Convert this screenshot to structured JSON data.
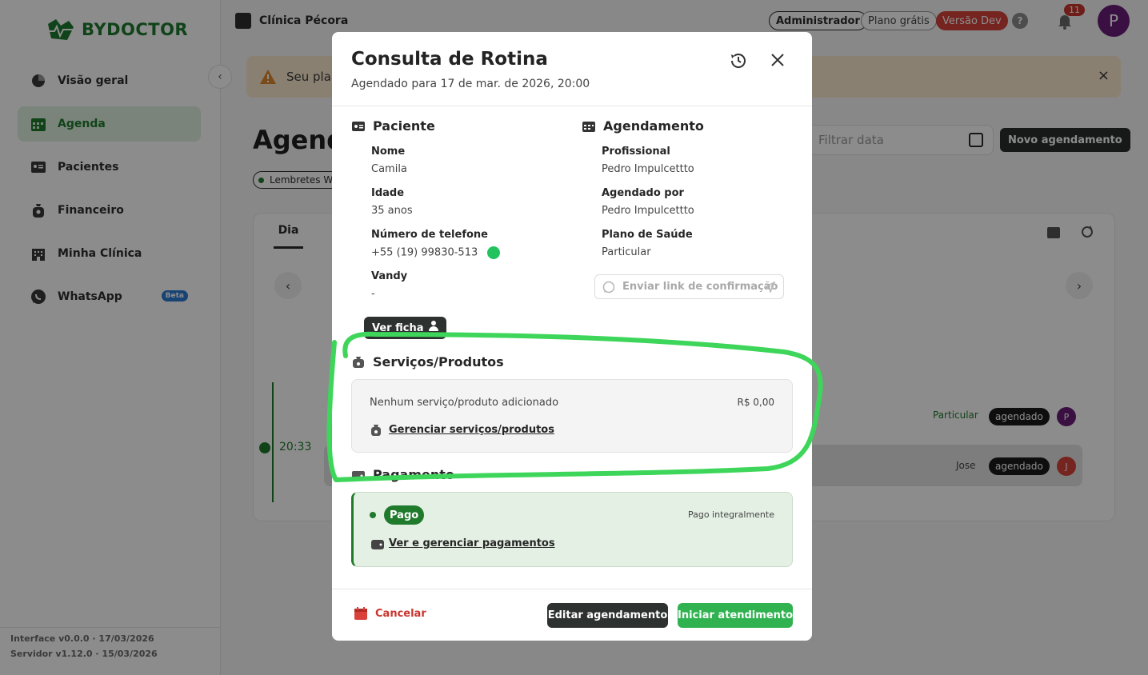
{
  "brand": {
    "name": "BYDOCTOR",
    "color": "#1e7a2e"
  },
  "sidebar": {
    "items": [
      {
        "label": "Visão geral",
        "icon": "pie-chart-icon"
      },
      {
        "label": "Agenda",
        "icon": "calendar-icon",
        "active": true
      },
      {
        "label": "Pacientes",
        "icon": "id-card-icon"
      },
      {
        "label": "Financeiro",
        "icon": "money-bag-icon"
      },
      {
        "label": "Minha Clínica",
        "icon": "building-icon"
      },
      {
        "label": "WhatsApp",
        "icon": "whatsapp-icon",
        "badge": "Beta"
      }
    ],
    "version_interface": "Interface v0.0.0 · 17/03/2026",
    "version_server": "Servidor v1.12.0 · 15/03/2026"
  },
  "header": {
    "clinic": "Clínica Pécora",
    "role": "Administrador",
    "plan": "Plano grátis",
    "env": "Versão Dev",
    "help": "?",
    "notifications": "11",
    "avatar": "P"
  },
  "background": {
    "banner_text": "Seu plan",
    "banner_close": "×",
    "title": "Agend",
    "reminder": "Lembretes W",
    "filter_placeholder": "Filtrar data",
    "new_button": "Novo agendamento",
    "tab": "Dia",
    "time": "20:33",
    "rows": [
      {
        "tag": "Particular",
        "status": "agendado",
        "avatar": "P"
      },
      {
        "tag": "Jose",
        "status": "agendado",
        "avatar": "J"
      }
    ]
  },
  "modal": {
    "title": "Consulta de Rotina",
    "subtitle": "Agendado para 17 de mar. de 2026, 20:00",
    "patient": {
      "heading": "Paciente",
      "name_label": "Nome",
      "name": "Camila",
      "age_label": "Idade",
      "age": "35 anos",
      "phone_label": "Número de telefone",
      "phone": "+55 (19) 99830-513",
      "vandy_label": "Vandy",
      "vandy": "-",
      "record_button": "Ver ficha"
    },
    "schedule": {
      "heading": "Agendamento",
      "professional_label": "Profissional",
      "professional": "Pedro Impulcettto",
      "by_label": "Agendado por",
      "by": "Pedro Impulcettto",
      "plan_label": "Plano de Saúde",
      "plan": "Particular",
      "confirm_button": "Enviar link de confirmação"
    },
    "services": {
      "heading": "Serviços/Produtos",
      "empty": "Nenhum serviço/produto adicionado",
      "total": "R$ 0,00",
      "manage_link": "Gerenciar serviços/produtos"
    },
    "payment": {
      "heading": "Pagamento",
      "status": "Pago",
      "detail": "Pago integralmente",
      "manage_link": "Ver e gerenciar pagamentos"
    },
    "footer": {
      "cancel": "Cancelar",
      "edit": "Editar agendamento",
      "start": "Iniciar atendimento"
    }
  },
  "colors": {
    "accent": "#2fb24f",
    "dark": "#2d312f",
    "danger": "#c9352d",
    "annotation": "#3ed65a"
  }
}
